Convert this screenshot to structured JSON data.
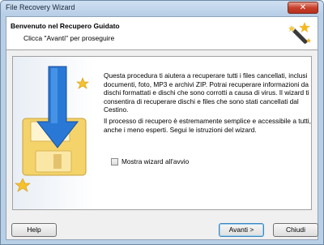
{
  "window": {
    "title": "File Recovery Wizard",
    "close_glyph": "✕"
  },
  "header": {
    "title": "Benvenuto nel Recupero Guidato",
    "subtitle": "Clicca \"Avanti\" per proseguire",
    "icon": "magic-wand-icon"
  },
  "main": {
    "intro": "Questa procedura ti aiutera a recuperare tutti i files cancellati, inclusi documenti, foto, MP3 e archivi ZIP. Potrai recuperare informazioni da dischi formattati e dischi che sono corrotti a causa di virus. Il wizard ti consentira di recuperare dischi e files che sono stati cancellati dal Cestino.",
    "para2": "Il processo di recupero è estremamente semplice e accessibile a tutti, anche i meno esperti. Segui le istruzioni del wizard.",
    "checkbox_label": "Mostra wizard all'avvio",
    "checkbox_checked": false,
    "illustration": "floppy-disk-arrow-illustration"
  },
  "buttons": {
    "help": "Help",
    "next": "Avanti >",
    "close": "Chiudi"
  },
  "colors": {
    "arrow_blue": "#1f6fd0",
    "star_yellow": "#f5c22a",
    "floppy_yellow": "#f7d874"
  }
}
